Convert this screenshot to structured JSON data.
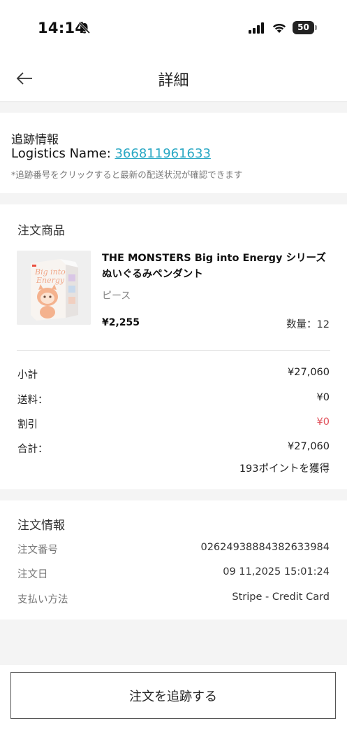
{
  "status_bar": {
    "time": "14:14",
    "battery": "50"
  },
  "header": {
    "title": "詳細"
  },
  "tracking": {
    "title": "追跡情報",
    "logistics_label": "Logistics Name: ",
    "tracking_number": "366811961633",
    "note": "*追跡番号をクリックすると最新の配送状況が確認できます"
  },
  "order_items": {
    "title": "注文商品",
    "product": {
      "name": "THE MONSTERS Big into Energy シリーズ ぬいぐるみペンダント",
      "variant": "ピース",
      "price": "¥2,255",
      "quantity": "数量：12"
    },
    "summary": [
      {
        "label": "小計",
        "value": "¥27,060"
      },
      {
        "label": "送料：",
        "value": "¥0"
      },
      {
        "label": "割引",
        "value": "¥0"
      },
      {
        "label": "合計：",
        "value": "¥27,060"
      }
    ],
    "points": "193ポイントを獲得",
    "discount_color": "#e0505a"
  },
  "order_info": {
    "title": "注文情報",
    "rows": [
      {
        "label": "注文番号",
        "value": "02624938884382633984"
      },
      {
        "label": "注文日",
        "value": "09 11,2025 15:01:24"
      },
      {
        "label": "支払い方法",
        "value": "Stripe - Credit Card"
      }
    ]
  },
  "footer": {
    "track_button_label": "注文を追跡する"
  },
  "accent_color": "#2aa8c4"
}
